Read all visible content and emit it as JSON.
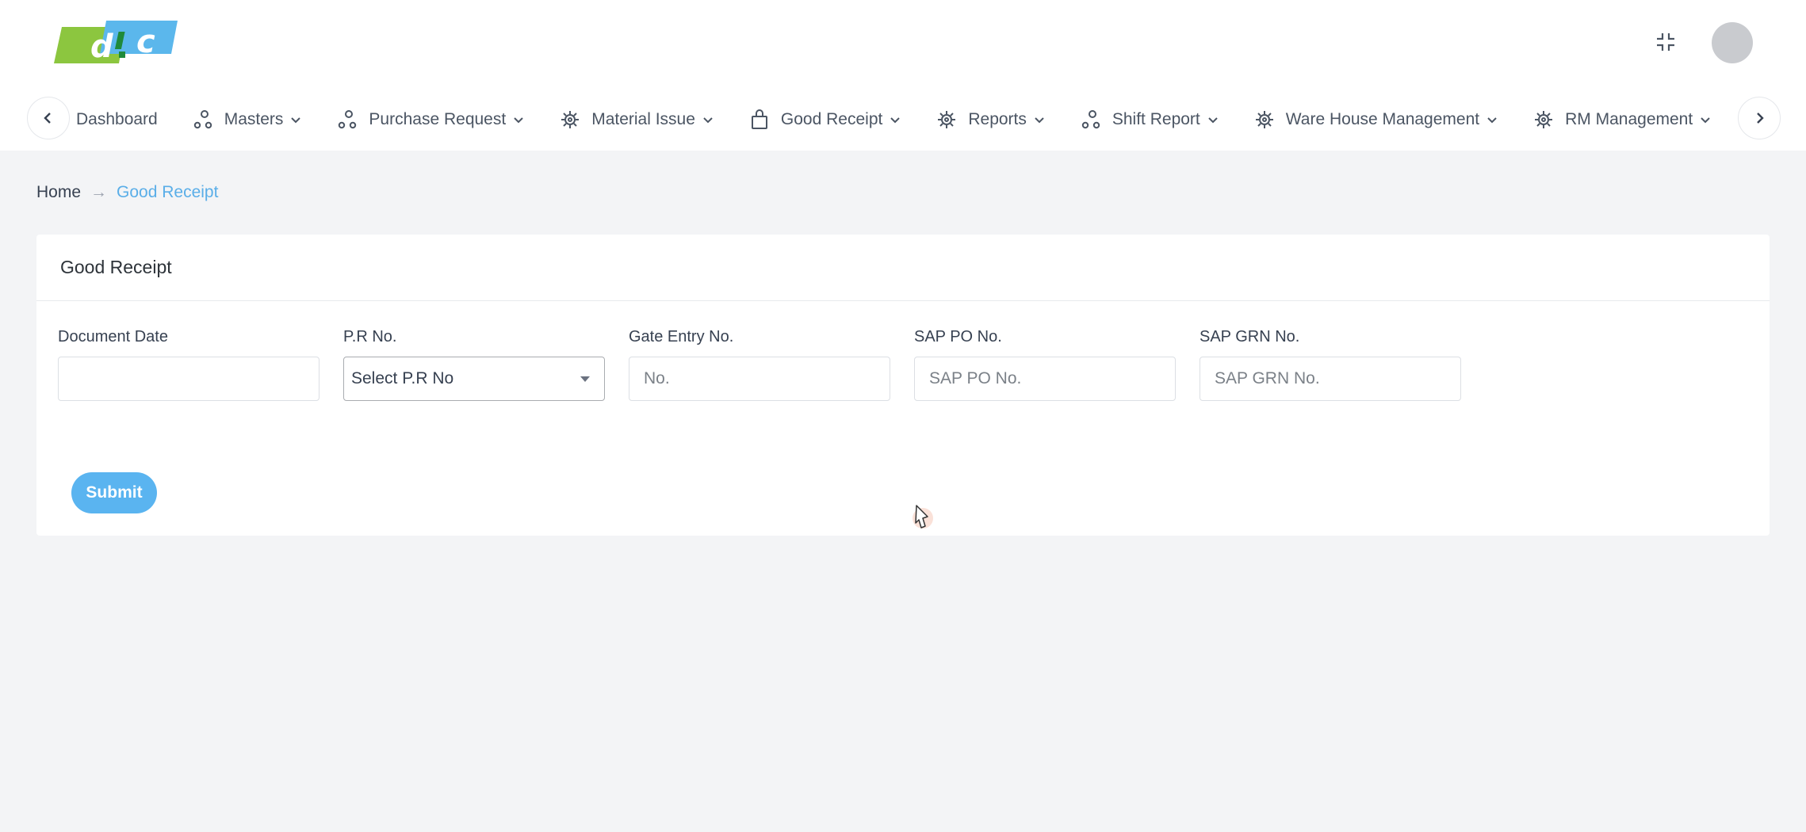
{
  "header": {
    "logo_text": "d!c",
    "fullscreen_icon": "compress-icon",
    "avatar_icon": "user-avatar"
  },
  "nav": {
    "items": [
      {
        "label": "Dashboard",
        "icon": "dashboard-icon",
        "has_dropdown": false
      },
      {
        "label": "Masters",
        "icon": "nodes-icon",
        "has_dropdown": true
      },
      {
        "label": "Purchase Request",
        "icon": "nodes-icon",
        "has_dropdown": true
      },
      {
        "label": "Material Issue",
        "icon": "gear-icon",
        "has_dropdown": true
      },
      {
        "label": "Good Receipt",
        "icon": "bag-icon",
        "has_dropdown": true
      },
      {
        "label": "Reports",
        "icon": "gear-icon",
        "has_dropdown": true
      },
      {
        "label": "Shift Report",
        "icon": "nodes-icon",
        "has_dropdown": true
      },
      {
        "label": "Ware House Management",
        "icon": "gear-icon",
        "has_dropdown": true
      },
      {
        "label": "RM Management",
        "icon": "gear-icon",
        "has_dropdown": true
      }
    ]
  },
  "breadcrumb": {
    "home": "Home",
    "separator": "→",
    "current": "Good Receipt"
  },
  "card": {
    "title": "Good Receipt",
    "fields": {
      "document_date": {
        "label": "Document Date",
        "value": "",
        "placeholder": ""
      },
      "pr_no": {
        "label": "P.R No.",
        "selected": "Select P.R No"
      },
      "gate_entry_no": {
        "label": "Gate Entry No.",
        "placeholder": "No."
      },
      "sap_po_no": {
        "label": "SAP PO No.",
        "placeholder": "SAP PO No."
      },
      "sap_grn_no": {
        "label": "SAP GRN No.",
        "placeholder": "SAP GRN No."
      }
    },
    "submit_label": "Submit"
  },
  "colors": {
    "accent": "#5ab4f0",
    "breadcrumb_active": "#5aaee8",
    "logo_green": "#8cc63f",
    "logo_blue": "#5bb7ec"
  }
}
